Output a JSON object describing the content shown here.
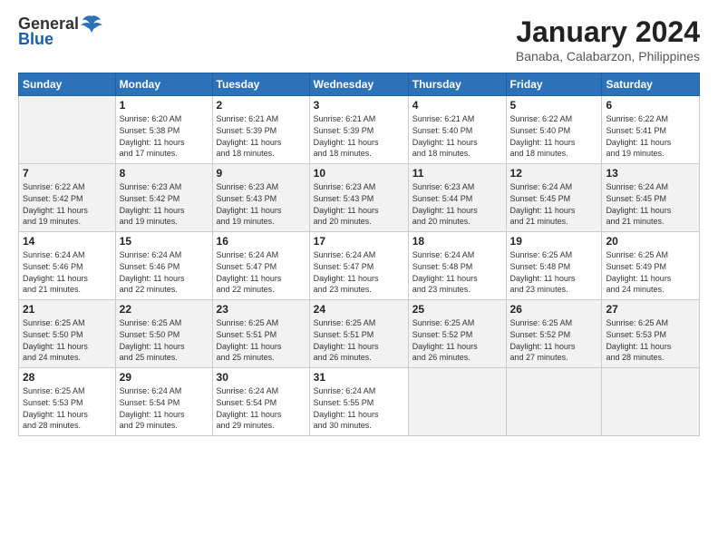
{
  "header": {
    "logo_general": "General",
    "logo_blue": "Blue",
    "title": "January 2024",
    "subtitle": "Banaba, Calabarzon, Philippines"
  },
  "days_of_week": [
    "Sunday",
    "Monday",
    "Tuesday",
    "Wednesday",
    "Thursday",
    "Friday",
    "Saturday"
  ],
  "weeks": [
    [
      {
        "day": "",
        "info": ""
      },
      {
        "day": "1",
        "info": "Sunrise: 6:20 AM\nSunset: 5:38 PM\nDaylight: 11 hours\nand 17 minutes."
      },
      {
        "day": "2",
        "info": "Sunrise: 6:21 AM\nSunset: 5:39 PM\nDaylight: 11 hours\nand 18 minutes."
      },
      {
        "day": "3",
        "info": "Sunrise: 6:21 AM\nSunset: 5:39 PM\nDaylight: 11 hours\nand 18 minutes."
      },
      {
        "day": "4",
        "info": "Sunrise: 6:21 AM\nSunset: 5:40 PM\nDaylight: 11 hours\nand 18 minutes."
      },
      {
        "day": "5",
        "info": "Sunrise: 6:22 AM\nSunset: 5:40 PM\nDaylight: 11 hours\nand 18 minutes."
      },
      {
        "day": "6",
        "info": "Sunrise: 6:22 AM\nSunset: 5:41 PM\nDaylight: 11 hours\nand 19 minutes."
      }
    ],
    [
      {
        "day": "7",
        "info": "Sunrise: 6:22 AM\nSunset: 5:42 PM\nDaylight: 11 hours\nand 19 minutes."
      },
      {
        "day": "8",
        "info": "Sunrise: 6:23 AM\nSunset: 5:42 PM\nDaylight: 11 hours\nand 19 minutes."
      },
      {
        "day": "9",
        "info": "Sunrise: 6:23 AM\nSunset: 5:43 PM\nDaylight: 11 hours\nand 19 minutes."
      },
      {
        "day": "10",
        "info": "Sunrise: 6:23 AM\nSunset: 5:43 PM\nDaylight: 11 hours\nand 20 minutes."
      },
      {
        "day": "11",
        "info": "Sunrise: 6:23 AM\nSunset: 5:44 PM\nDaylight: 11 hours\nand 20 minutes."
      },
      {
        "day": "12",
        "info": "Sunrise: 6:24 AM\nSunset: 5:45 PM\nDaylight: 11 hours\nand 21 minutes."
      },
      {
        "day": "13",
        "info": "Sunrise: 6:24 AM\nSunset: 5:45 PM\nDaylight: 11 hours\nand 21 minutes."
      }
    ],
    [
      {
        "day": "14",
        "info": "Sunrise: 6:24 AM\nSunset: 5:46 PM\nDaylight: 11 hours\nand 21 minutes."
      },
      {
        "day": "15",
        "info": "Sunrise: 6:24 AM\nSunset: 5:46 PM\nDaylight: 11 hours\nand 22 minutes."
      },
      {
        "day": "16",
        "info": "Sunrise: 6:24 AM\nSunset: 5:47 PM\nDaylight: 11 hours\nand 22 minutes."
      },
      {
        "day": "17",
        "info": "Sunrise: 6:24 AM\nSunset: 5:47 PM\nDaylight: 11 hours\nand 23 minutes."
      },
      {
        "day": "18",
        "info": "Sunrise: 6:24 AM\nSunset: 5:48 PM\nDaylight: 11 hours\nand 23 minutes."
      },
      {
        "day": "19",
        "info": "Sunrise: 6:25 AM\nSunset: 5:48 PM\nDaylight: 11 hours\nand 23 minutes."
      },
      {
        "day": "20",
        "info": "Sunrise: 6:25 AM\nSunset: 5:49 PM\nDaylight: 11 hours\nand 24 minutes."
      }
    ],
    [
      {
        "day": "21",
        "info": "Sunrise: 6:25 AM\nSunset: 5:50 PM\nDaylight: 11 hours\nand 24 minutes."
      },
      {
        "day": "22",
        "info": "Sunrise: 6:25 AM\nSunset: 5:50 PM\nDaylight: 11 hours\nand 25 minutes."
      },
      {
        "day": "23",
        "info": "Sunrise: 6:25 AM\nSunset: 5:51 PM\nDaylight: 11 hours\nand 25 minutes."
      },
      {
        "day": "24",
        "info": "Sunrise: 6:25 AM\nSunset: 5:51 PM\nDaylight: 11 hours\nand 26 minutes."
      },
      {
        "day": "25",
        "info": "Sunrise: 6:25 AM\nSunset: 5:52 PM\nDaylight: 11 hours\nand 26 minutes."
      },
      {
        "day": "26",
        "info": "Sunrise: 6:25 AM\nSunset: 5:52 PM\nDaylight: 11 hours\nand 27 minutes."
      },
      {
        "day": "27",
        "info": "Sunrise: 6:25 AM\nSunset: 5:53 PM\nDaylight: 11 hours\nand 28 minutes."
      }
    ],
    [
      {
        "day": "28",
        "info": "Sunrise: 6:25 AM\nSunset: 5:53 PM\nDaylight: 11 hours\nand 28 minutes."
      },
      {
        "day": "29",
        "info": "Sunrise: 6:24 AM\nSunset: 5:54 PM\nDaylight: 11 hours\nand 29 minutes."
      },
      {
        "day": "30",
        "info": "Sunrise: 6:24 AM\nSunset: 5:54 PM\nDaylight: 11 hours\nand 29 minutes."
      },
      {
        "day": "31",
        "info": "Sunrise: 6:24 AM\nSunset: 5:55 PM\nDaylight: 11 hours\nand 30 minutes."
      },
      {
        "day": "",
        "info": ""
      },
      {
        "day": "",
        "info": ""
      },
      {
        "day": "",
        "info": ""
      }
    ]
  ]
}
